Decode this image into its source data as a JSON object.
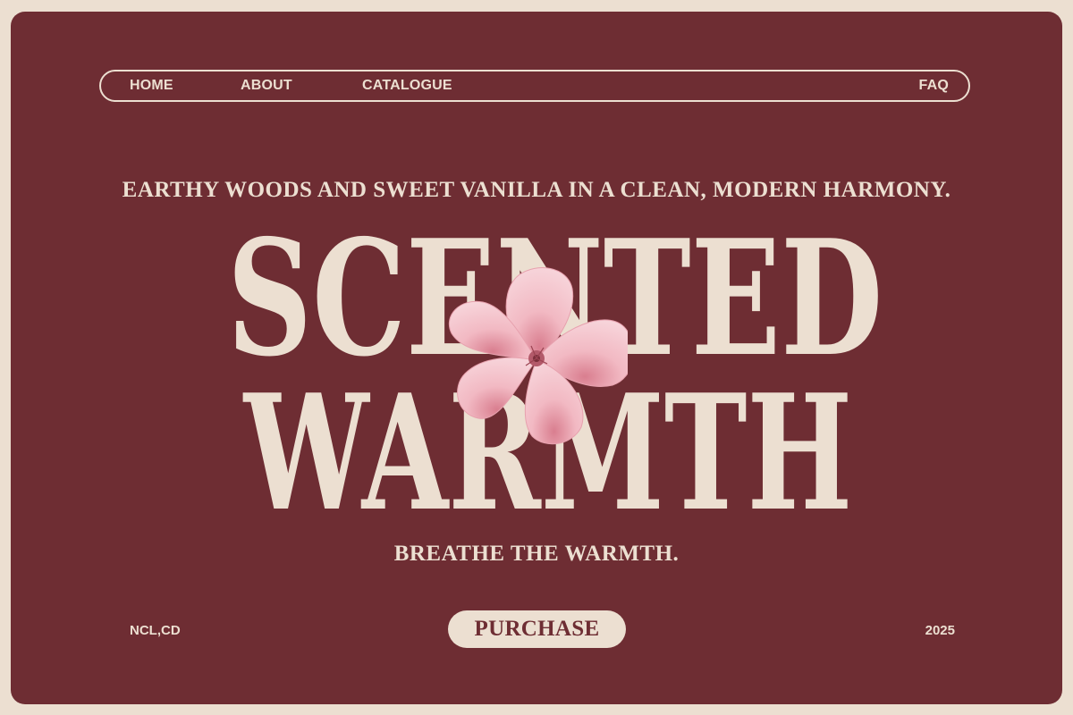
{
  "nav": {
    "home": "HOME",
    "about": "ABOUT",
    "catalogue": "CATALOGUE",
    "faq": "FAQ"
  },
  "hero": {
    "tagline": "EARTHY WOODS AND SWEET VANILLA IN A CLEAN, MODERN HARMONY.",
    "headline_line1": "SCENTED",
    "headline_line2": "WARMTH",
    "subline": "BREATHE THE WARMTH."
  },
  "footer": {
    "left_text": "NCL,CD",
    "purchase_label": "PURCHASE",
    "year": "2025"
  },
  "colors": {
    "background": "#ecdfd1",
    "card": "#6e2d33",
    "text": "#ecdfd1",
    "flower": "#f0b3bd"
  },
  "icons": {
    "hero_image": "hibiscus-flower"
  }
}
